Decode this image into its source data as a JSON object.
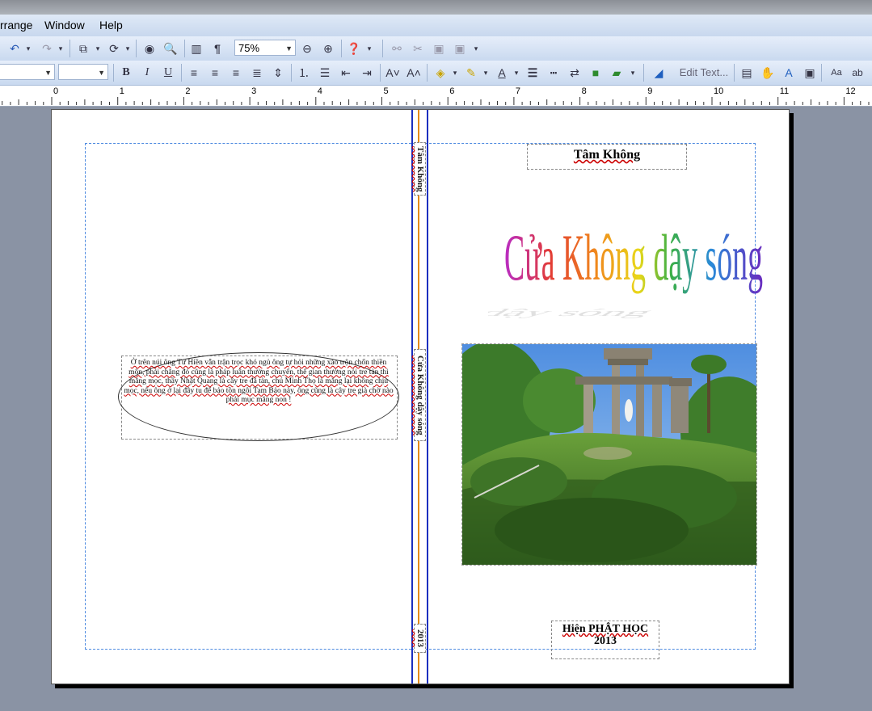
{
  "menu": {
    "arrange": "rrange",
    "window": "Window",
    "help": "Help"
  },
  "toolbar1": {
    "zoom": "75%"
  },
  "toolbar2": {
    "font_name": "",
    "font_size": "",
    "edit_text": "Edit Text..."
  },
  "ruler": {
    "marks": [
      "0",
      "1",
      "2",
      "3",
      "4",
      "5",
      "6",
      "7",
      "8",
      "9",
      "10",
      "11",
      "12"
    ]
  },
  "cover": {
    "author": "Tâm Không",
    "title": "Cửa Không dậy sóng",
    "publisher": "Hiện PHẬT HỌC",
    "year": "2013",
    "spine_author": "Tâm Không",
    "spine_title": "Cửa Không dậy sóng",
    "spine_year": "2013",
    "blurb": "Ở trên núi ông Tư Hiền vẫn trận trọc khó ngủ ông tự hỏi những xáo trộn chốn thiền môn, phải chăng đó cũng là pháp luân thường chuyển, thế gian thường nói tre tàn thì măng mọc, thầy Nhật Quang là cây tre đã tàn, chú Minh Thọ là măng lại không chịu mọc, nếu ông ở lại đây tu để bảo tồn ngôi Tam Bảo này, ông cũng là cây tre già chờ nào phải mục măng non !"
  },
  "colors": {
    "menubar": "#dfe9f7",
    "workspace": "#8a93a4",
    "guide": "#4f8be0"
  }
}
